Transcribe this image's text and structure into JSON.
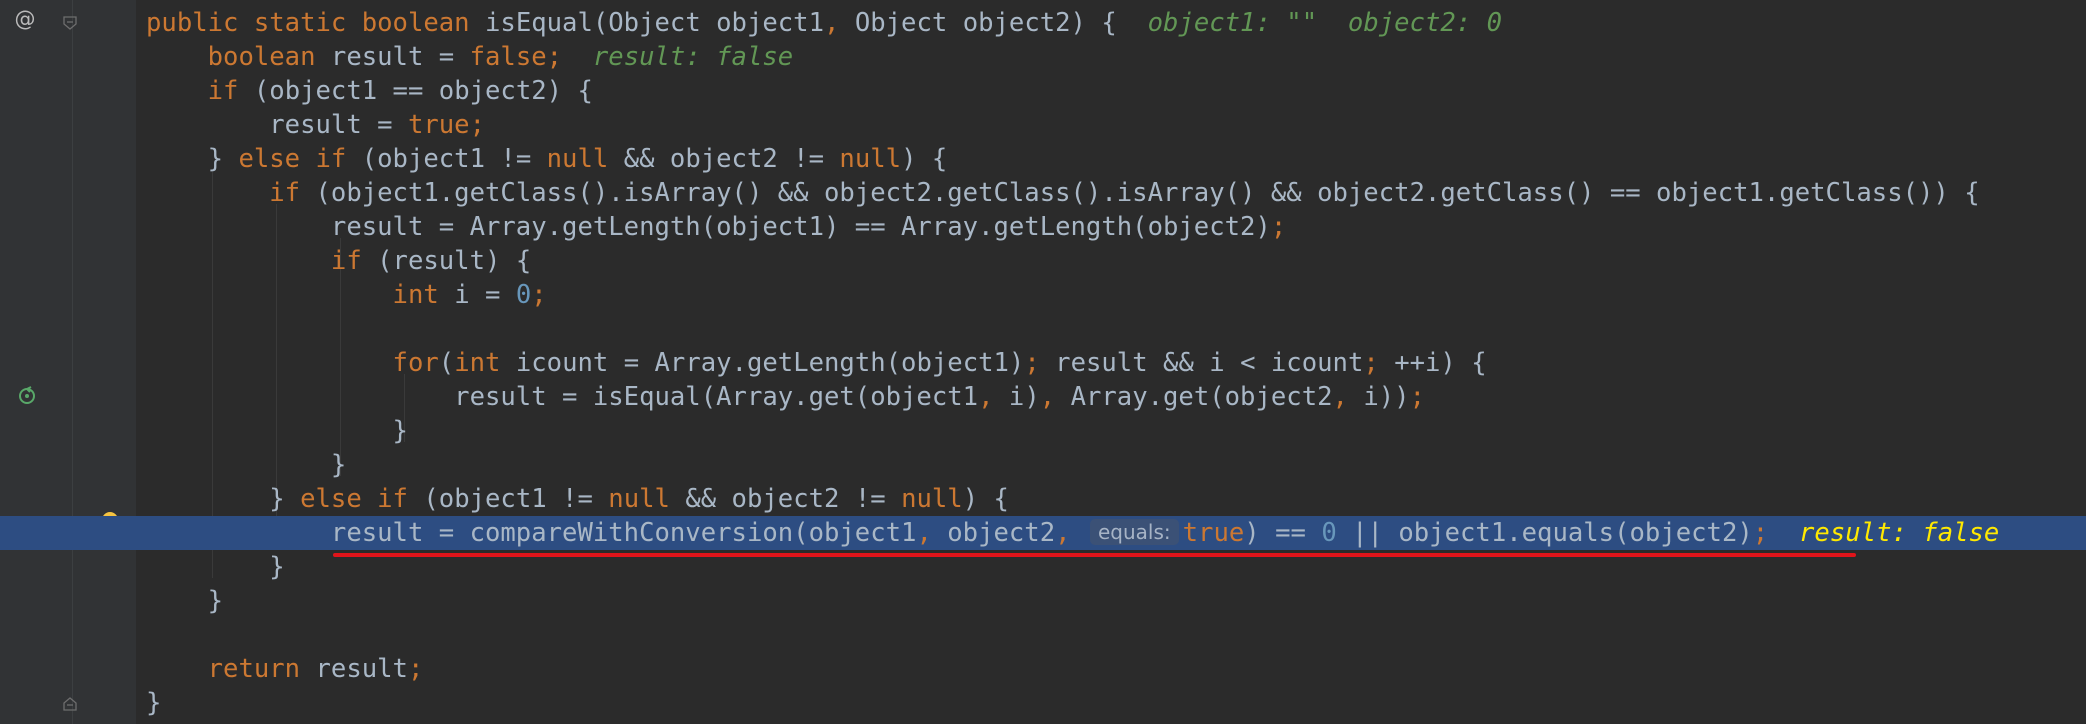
{
  "gutter": {
    "at_symbol": "@"
  },
  "lines": [
    {
      "id": "l1",
      "tokens": [
        {
          "t": "public static boolean ",
          "c": "kw"
        },
        {
          "t": "isEqual(Object object1",
          "c": ""
        },
        {
          "t": ", ",
          "c": "punc"
        },
        {
          "t": "Object object2) {  ",
          "c": ""
        },
        {
          "t": "object1: \"\"  object2: 0",
          "c": "dbg"
        }
      ]
    },
    {
      "id": "l2",
      "tokens": [
        {
          "t": "    boolean ",
          "c": "kw"
        },
        {
          "t": "result = ",
          "c": ""
        },
        {
          "t": "false",
          "c": "kw"
        },
        {
          "t": ";  ",
          "c": "punc"
        },
        {
          "t": "result: false",
          "c": "dbg"
        }
      ]
    },
    {
      "id": "l3",
      "tokens": [
        {
          "t": "    if ",
          "c": "kw"
        },
        {
          "t": "(object1 == object2) {",
          "c": ""
        }
      ]
    },
    {
      "id": "l4",
      "tokens": [
        {
          "t": "        result = ",
          "c": ""
        },
        {
          "t": "true",
          "c": "kw"
        },
        {
          "t": ";",
          "c": "punc"
        }
      ]
    },
    {
      "id": "l5",
      "tokens": [
        {
          "t": "    } ",
          "c": ""
        },
        {
          "t": "else if ",
          "c": "kw"
        },
        {
          "t": "(object1 != ",
          "c": ""
        },
        {
          "t": "null ",
          "c": "kw"
        },
        {
          "t": "&& object2 != ",
          "c": ""
        },
        {
          "t": "null",
          "c": "kw"
        },
        {
          "t": ") {",
          "c": ""
        }
      ]
    },
    {
      "id": "l6",
      "tokens": [
        {
          "t": "        if ",
          "c": "kw"
        },
        {
          "t": "(object1.getClass().isArray() && object2.getClass().isArray() && object2.getClass() == object1.getClass()) {",
          "c": ""
        }
      ]
    },
    {
      "id": "l7",
      "tokens": [
        {
          "t": "            result = Array.getLength(object1) == Array.getLength(object2)",
          "c": ""
        },
        {
          "t": ";",
          "c": "punc"
        }
      ]
    },
    {
      "id": "l8",
      "tokens": [
        {
          "t": "            if ",
          "c": "kw"
        },
        {
          "t": "(result) {",
          "c": ""
        }
      ]
    },
    {
      "id": "l9",
      "tokens": [
        {
          "t": "                int ",
          "c": "kw"
        },
        {
          "t": "i = ",
          "c": ""
        },
        {
          "t": "0",
          "c": "num"
        },
        {
          "t": ";",
          "c": "punc"
        }
      ]
    },
    {
      "id": "l10",
      "tokens": []
    },
    {
      "id": "l11",
      "tokens": [
        {
          "t": "                for",
          "c": "kw"
        },
        {
          "t": "(",
          "c": ""
        },
        {
          "t": "int ",
          "c": "kw"
        },
        {
          "t": "icount = Array.getLength(object1)",
          "c": ""
        },
        {
          "t": "; ",
          "c": "punc"
        },
        {
          "t": "result && i < icount",
          "c": ""
        },
        {
          "t": "; ",
          "c": "punc"
        },
        {
          "t": "++i) {",
          "c": ""
        }
      ]
    },
    {
      "id": "l12",
      "tokens": [
        {
          "t": "                    result = isEqual(Array.get(object1",
          "c": ""
        },
        {
          "t": ", ",
          "c": "punc"
        },
        {
          "t": "i)",
          "c": ""
        },
        {
          "t": ", ",
          "c": "punc"
        },
        {
          "t": "Array.get(object2",
          "c": ""
        },
        {
          "t": ", ",
          "c": "punc"
        },
        {
          "t": "i))",
          "c": ""
        },
        {
          "t": ";",
          "c": "punc"
        }
      ]
    },
    {
      "id": "l13",
      "tokens": [
        {
          "t": "                }",
          "c": ""
        }
      ]
    },
    {
      "id": "l14",
      "tokens": [
        {
          "t": "            }",
          "c": ""
        }
      ]
    },
    {
      "id": "l15",
      "tokens": [
        {
          "t": "        } ",
          "c": ""
        },
        {
          "t": "else if ",
          "c": "kw"
        },
        {
          "t": "(object1 != ",
          "c": ""
        },
        {
          "t": "null ",
          "c": "kw"
        },
        {
          "t": "&& object2 != ",
          "c": ""
        },
        {
          "t": "null",
          "c": "kw"
        },
        {
          "t": ") {",
          "c": ""
        }
      ]
    },
    {
      "id": "l16",
      "highlighted": true,
      "tokens": [
        {
          "t": "            result = compareWithConversion(object1",
          "c": ""
        },
        {
          "t": ", ",
          "c": "punc"
        },
        {
          "t": "object2",
          "c": ""
        },
        {
          "t": ", ",
          "c": "punc"
        },
        {
          "t": "equals:",
          "c": "hint"
        },
        {
          "t": "true",
          "c": "kw"
        },
        {
          "t": ") == ",
          "c": ""
        },
        {
          "t": "0",
          "c": "num"
        },
        {
          "t": " || object1.equals(object2)",
          "c": ""
        },
        {
          "t": ";",
          "c": "punc"
        },
        {
          "t": "  result: false",
          "c": "dbg-hl"
        }
      ]
    },
    {
      "id": "l17",
      "tokens": [
        {
          "t": "        }",
          "c": ""
        }
      ]
    },
    {
      "id": "l18",
      "tokens": [
        {
          "t": "    }",
          "c": ""
        }
      ]
    },
    {
      "id": "l19",
      "tokens": []
    },
    {
      "id": "l20",
      "tokens": [
        {
          "t": "    return ",
          "c": "kw"
        },
        {
          "t": "result",
          "c": ""
        },
        {
          "t": ";",
          "c": "punc"
        }
      ]
    },
    {
      "id": "l21",
      "tokens": [
        {
          "t": "}",
          "c": ""
        }
      ]
    }
  ]
}
